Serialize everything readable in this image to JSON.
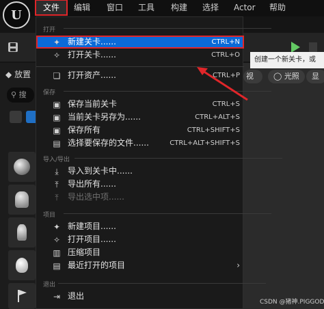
{
  "menubar": {
    "logo_text": "U",
    "items": [
      "文件",
      "编辑",
      "窗口",
      "工具",
      "构建",
      "选择",
      "Actor",
      "帮助"
    ]
  },
  "file_menu": {
    "sections": {
      "open": "打开",
      "save": "保存",
      "import_export": "导入/导出",
      "project": "项目",
      "exit": "退出"
    },
    "items": [
      {
        "label": "新建关卡......",
        "shortcut": "CTRL+N",
        "icon": "new-level-icon"
      },
      {
        "label": "打开关卡......",
        "shortcut": "CTRL+O",
        "icon": "open-level-icon"
      },
      {
        "label": "打开资产......",
        "shortcut": "CTRL+P",
        "icon": "open-asset-icon"
      },
      {
        "label": "保存当前关卡",
        "shortcut": "CTRL+S",
        "icon": "save-icon"
      },
      {
        "label": "当前关卡另存为......",
        "shortcut": "CTRL+ALT+S",
        "icon": "save-as-icon"
      },
      {
        "label": "保存所有",
        "shortcut": "CTRL+SHIFT+S",
        "icon": "save-all-icon"
      },
      {
        "label": "选择要保存的文件......",
        "shortcut": "CTRL+ALT+SHIFT+S",
        "icon": "choose-files-icon"
      },
      {
        "label": "导入到关卡中......",
        "shortcut": "",
        "icon": "import-icon"
      },
      {
        "label": "导出所有......",
        "shortcut": "",
        "icon": "export-all-icon"
      },
      {
        "label": "导出选中项......",
        "shortcut": "",
        "icon": "export-selected-icon",
        "disabled": true
      },
      {
        "label": "新建项目......",
        "shortcut": "",
        "icon": "new-project-icon"
      },
      {
        "label": "打开项目......",
        "shortcut": "",
        "icon": "open-project-icon"
      },
      {
        "label": "压缩项目",
        "shortcut": "",
        "icon": "zip-project-icon"
      },
      {
        "label": "最近打开的项目",
        "shortcut": "",
        "icon": "recent-projects-icon",
        "submenu_arrow": "›"
      },
      {
        "label": "退出",
        "shortcut": "",
        "icon": "exit-icon"
      }
    ]
  },
  "left_panel": {
    "place_label": "放置",
    "search_placeholder": "搜"
  },
  "viewport": {
    "buttons": [
      "视",
      "光照",
      "显"
    ]
  },
  "tooltip": {
    "text": "创建一个新关卡，或"
  },
  "watermark": "CSDN @猪神.PIGGOD",
  "colors": {
    "highlight": "#0a6ad8",
    "annotation_red": "#e0262a",
    "menu_bg": "#1a1a1a"
  }
}
